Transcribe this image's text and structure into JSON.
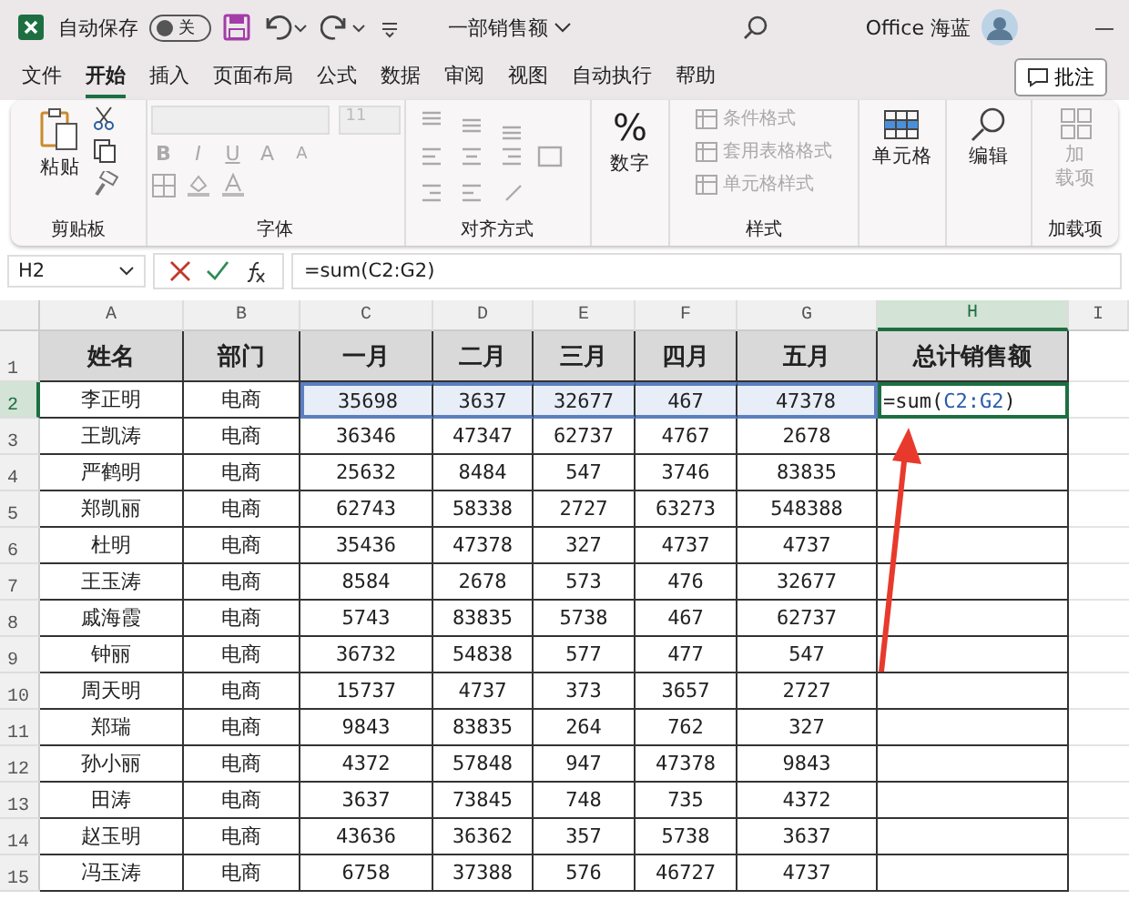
{
  "title_bar": {
    "autosave_label": "自动保存",
    "autosave": {
      "on": false,
      "label": "关"
    },
    "doc_title": "一部销售额",
    "user": "Office 海蓝",
    "minimize": "—"
  },
  "ribbon_tabs": [
    {
      "label": "文件",
      "selected": false
    },
    {
      "label": "开始",
      "selected": true
    },
    {
      "label": "插入",
      "selected": false
    },
    {
      "label": "页面布局",
      "selected": false
    },
    {
      "label": "公式",
      "selected": false
    },
    {
      "label": "数据",
      "selected": false
    },
    {
      "label": "审阅",
      "selected": false
    },
    {
      "label": "视图",
      "selected": false
    },
    {
      "label": "自动执行",
      "selected": false
    },
    {
      "label": "帮助",
      "selected": false
    }
  ],
  "comment_button": "批注",
  "ribbon": {
    "clipboard": {
      "paste": "粘贴",
      "label": "剪贴板"
    },
    "font": {
      "size": "11",
      "styles": [
        "B",
        "I",
        "U"
      ],
      "grow": "A",
      "shrink": "A",
      "label": "字体"
    },
    "alignment": {
      "label": "对齐方式"
    },
    "number": {
      "symbol": "%",
      "button": "数字"
    },
    "styles": {
      "items": [
        "条件格式",
        "套用表格格式",
        "单元格样式"
      ],
      "label": "样式"
    },
    "cells": {
      "button": "单元格"
    },
    "editing": {
      "button": "编辑"
    },
    "addins": {
      "button": [
        "加",
        "载项"
      ],
      "label": "加载项"
    }
  },
  "formula_bar": {
    "name_box": "H2",
    "formula": "=sum(C2:G2)"
  },
  "sheet": {
    "columns": [
      {
        "label": "A",
        "selected": false
      },
      {
        "label": "B",
        "selected": false
      },
      {
        "label": "C",
        "selected": false
      },
      {
        "label": "D",
        "selected": false
      },
      {
        "label": "E",
        "selected": false
      },
      {
        "label": "F",
        "selected": false
      },
      {
        "label": "G",
        "selected": false
      },
      {
        "label": "H",
        "selected": true
      },
      {
        "label": "I",
        "selected": false
      }
    ],
    "header_row": "1",
    "header": [
      "姓名",
      "部门",
      "一月",
      "二月",
      "三月",
      "四月",
      "五月",
      "总计销售额"
    ],
    "rows": [
      {
        "n": "2",
        "selected": true,
        "cells": [
          "李正明",
          "电商",
          "35698",
          "3637",
          "32677",
          "467",
          "47378"
        ],
        "entry": {
          "start": "=sum(",
          "ref": "C2:G2",
          "end": ")"
        }
      },
      {
        "n": "3",
        "selected": false,
        "cells": [
          "王凯涛",
          "电商",
          "36346",
          "47347",
          "62737",
          "4767",
          "2678"
        ]
      },
      {
        "n": "4",
        "selected": false,
        "cells": [
          "严鹤明",
          "电商",
          "25632",
          "8484",
          "547",
          "3746",
          "83835"
        ]
      },
      {
        "n": "5",
        "selected": false,
        "cells": [
          "郑凯丽",
          "电商",
          "62743",
          "58338",
          "2727",
          "63273",
          "548388"
        ]
      },
      {
        "n": "6",
        "selected": false,
        "cells": [
          "杜明",
          "电商",
          "35436",
          "47378",
          "327",
          "4737",
          "4737"
        ]
      },
      {
        "n": "7",
        "selected": false,
        "cells": [
          "王玉涛",
          "电商",
          "8584",
          "2678",
          "573",
          "476",
          "32677"
        ]
      },
      {
        "n": "8",
        "selected": false,
        "cells": [
          "戚海霞",
          "电商",
          "5743",
          "83835",
          "5738",
          "467",
          "62737"
        ]
      },
      {
        "n": "9",
        "selected": false,
        "cells": [
          "钟丽",
          "电商",
          "36732",
          "54838",
          "577",
          "477",
          "547"
        ]
      },
      {
        "n": "10",
        "selected": false,
        "cells": [
          "周天明",
          "电商",
          "15737",
          "4737",
          "373",
          "3657",
          "2727"
        ]
      },
      {
        "n": "11",
        "selected": false,
        "cells": [
          "郑瑞",
          "电商",
          "9843",
          "83835",
          "264",
          "762",
          "327"
        ]
      },
      {
        "n": "12",
        "selected": false,
        "cells": [
          "孙小丽",
          "电商",
          "4372",
          "57848",
          "947",
          "47378",
          "9843"
        ]
      },
      {
        "n": "13",
        "selected": false,
        "cells": [
          "田涛",
          "电商",
          "3637",
          "73845",
          "748",
          "735",
          "4372"
        ]
      },
      {
        "n": "14",
        "selected": false,
        "cells": [
          "赵玉明",
          "电商",
          "43636",
          "36362",
          "357",
          "5738",
          "3637"
        ]
      },
      {
        "n": "15",
        "selected": false,
        "cells": [
          "冯玉涛",
          "电商",
          "6758",
          "37388",
          "576",
          "46727",
          "4737"
        ]
      }
    ]
  }
}
